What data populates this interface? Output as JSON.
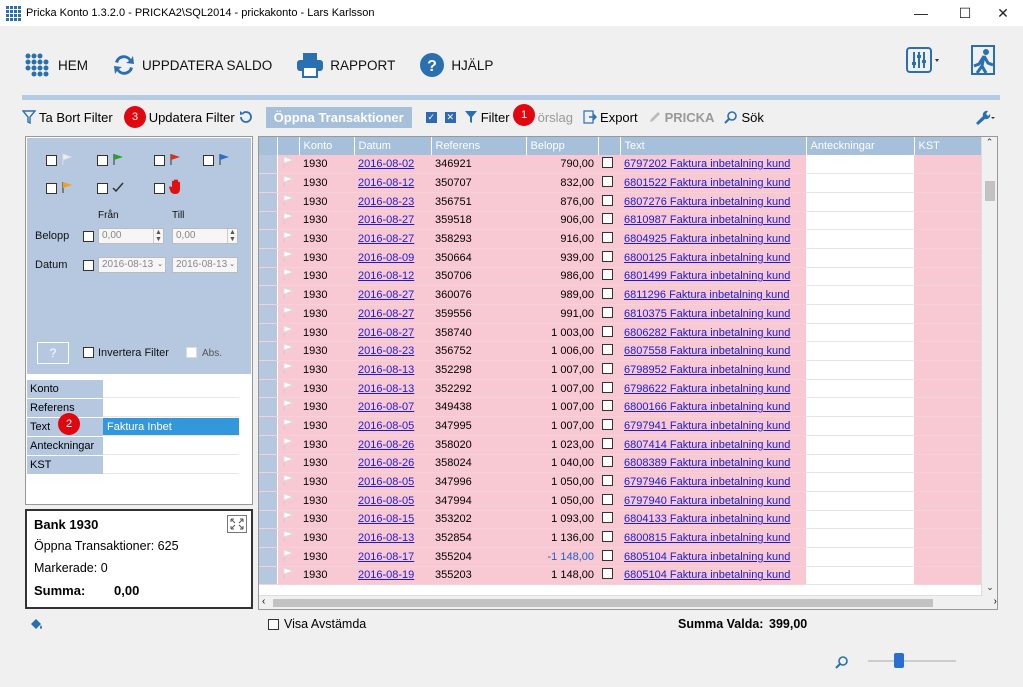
{
  "window": {
    "title": "Pricka Konto 1.3.2.0 - PRICKA2\\SQL2014 - prickakonto - Lars Karlsson",
    "minimize": "—",
    "maximize": "☐",
    "close": "✕"
  },
  "mainbar": {
    "hem": "HEM",
    "uppdatera": "UPPDATERA SALDO",
    "rapport": "RAPPORT",
    "hjalp": "HJÄLP"
  },
  "toolbar": {
    "ta_bort_filter": "Ta Bort Filter",
    "uppdatera_filter": "Updatera Filter",
    "oppna": "Öppna Transaktioner",
    "filter": "Filter",
    "forslag": "örslag",
    "export": "Export",
    "pricka": "PRICKA",
    "sok": "Sök",
    "badges": [
      "1",
      "2",
      "3"
    ]
  },
  "filter": {
    "fran": "Från",
    "till": "Till",
    "belopp": "Belopp",
    "datum": "Datum",
    "belopp_fran": "0,00",
    "belopp_till": "0,00",
    "datum_fran": "2016-08-13",
    "datum_till": "2016-08-13",
    "help": "?",
    "invertera": "Invertera Filter",
    "abs": "Abs."
  },
  "fields": [
    {
      "key": "Konto",
      "value": ""
    },
    {
      "key": "Referens",
      "value": ""
    },
    {
      "key": "Text",
      "value": "Faktura Inbet"
    },
    {
      "key": "Anteckningar",
      "value": ""
    },
    {
      "key": "KST",
      "value": ""
    }
  ],
  "info": {
    "bank": "Bank 1930",
    "oppna": "Öppna Transaktioner: 625",
    "markerade": "Markerade: 0",
    "summa_label": "Summa:",
    "summa_value": "0,00"
  },
  "columns": [
    "Konto",
    "Datum",
    "Referens",
    "Belopp",
    "",
    "Text",
    "Anteckningar",
    "KST"
  ],
  "rows": [
    [
      "1930",
      "2016-08-02",
      "346921",
      "790,00",
      "6797202 Faktura inbetalning kund"
    ],
    [
      "1930",
      "2016-08-12",
      "350707",
      "832,00",
      "6801522 Faktura inbetalning kund"
    ],
    [
      "1930",
      "2016-08-23",
      "356751",
      "876,00",
      "6807276 Faktura inbetalning kund"
    ],
    [
      "1930",
      "2016-08-27",
      "359518",
      "906,00",
      "6810987 Faktura inbetalning kund"
    ],
    [
      "1930",
      "2016-08-27",
      "358293",
      "916,00",
      "6804925 Faktura inbetalning kund"
    ],
    [
      "1930",
      "2016-08-09",
      "350664",
      "939,00",
      "6800125 Faktura inbetalning kund"
    ],
    [
      "1930",
      "2016-08-12",
      "350706",
      "986,00",
      "6801499 Faktura inbetalning kund"
    ],
    [
      "1930",
      "2016-08-27",
      "360076",
      "989,00",
      "6811296 Faktura inbetalning kund"
    ],
    [
      "1930",
      "2016-08-27",
      "359556",
      "991,00",
      "6810375 Faktura inbetalning kund"
    ],
    [
      "1930",
      "2016-08-27",
      "358740",
      "1 003,00",
      "6806282 Faktura inbetalning kund"
    ],
    [
      "1930",
      "2016-08-23",
      "356752",
      "1 006,00",
      "6807558 Faktura inbetalning kund"
    ],
    [
      "1930",
      "2016-08-13",
      "352298",
      "1 007,00",
      "6798952 Faktura inbetalning kund"
    ],
    [
      "1930",
      "2016-08-13",
      "352292",
      "1 007,00",
      "6798622 Faktura inbetalning kund"
    ],
    [
      "1930",
      "2016-08-07",
      "349438",
      "1 007,00",
      "6800166 Faktura inbetalning kund"
    ],
    [
      "1930",
      "2016-08-05",
      "347995",
      "1 007,00",
      "6797941 Faktura inbetalning kund"
    ],
    [
      "1930",
      "2016-08-26",
      "358020",
      "1 023,00",
      "6807414 Faktura inbetalning kund"
    ],
    [
      "1930",
      "2016-08-26",
      "358024",
      "1 040,00",
      "6808389 Faktura inbetalning kund"
    ],
    [
      "1930",
      "2016-08-05",
      "347996",
      "1 050,00",
      "6797946 Faktura inbetalning kund"
    ],
    [
      "1930",
      "2016-08-05",
      "347994",
      "1 050,00",
      "6797940 Faktura inbetalning kund"
    ],
    [
      "1930",
      "2016-08-15",
      "353202",
      "1 093,00",
      "6804133 Faktura inbetalning kund"
    ],
    [
      "1930",
      "2016-08-13",
      "352854",
      "1 136,00",
      "6800815 Faktura inbetalning kund"
    ],
    [
      "1930",
      "2016-08-17",
      "355204",
      "-1 148,00",
      "6805104 Faktura inbetalning kund"
    ],
    [
      "1930",
      "2016-08-19",
      "355203",
      "1 148,00",
      "6805104 Faktura inbetalning kund"
    ]
  ],
  "status": {
    "visa": "Visa Avstämda",
    "summa_valda_label": "Summa Valda:",
    "summa_valda_value": "399,00"
  }
}
